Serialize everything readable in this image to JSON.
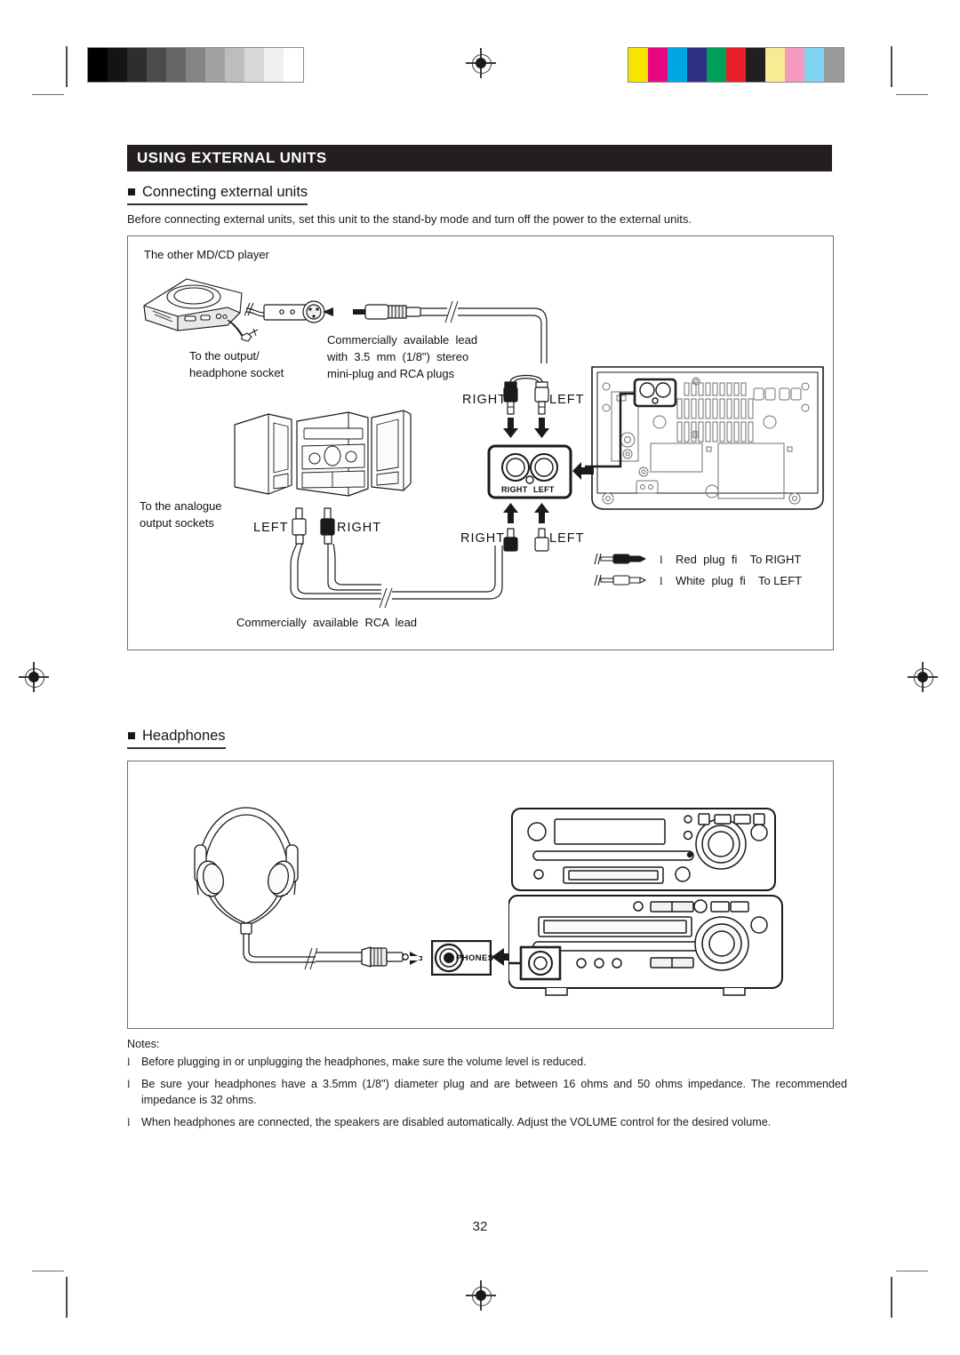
{
  "document": {
    "page_number": "32",
    "section_title": "USING EXTERNAL UNITS"
  },
  "connecting_section": {
    "bullet": "■",
    "heading": "Connecting external units",
    "intro": "Before connecting external units, set this unit to the stand-by mode and turn off the power to the external units.",
    "labels": {
      "md_player": "The other MD/CD player",
      "output_socket": "To the output/\nheadphone socket",
      "lead_desc": "Commercially  available  lead\nwith  3.5  mm  (1/8\")  stereo\nmini-plug and RCA plugs",
      "top_right": "RIGHT",
      "top_left": "LEFT",
      "jack_right": "RIGHT",
      "jack_left": "LEFT",
      "panel_right": "RIGHT",
      "panel_left": "LEFT",
      "analogue_sockets": "To the analogue\noutput sockets",
      "stereo_left": "LEFT",
      "stereo_right": "RIGHT",
      "rca_lead": "Commercially  available  RCA  lead"
    },
    "plug_legend": [
      {
        "bullet": "l",
        "text": "Red  plug  fi    To RIGHT"
      },
      {
        "bullet": "l",
        "text": "White  plug  fi    To LEFT"
      }
    ]
  },
  "headphones_section": {
    "bullet": "■",
    "heading": "Headphones",
    "jack_label": "PHONES"
  },
  "notes": {
    "title": "Notes:",
    "bullet": "l",
    "items": [
      "Before plugging in or unplugging the headphones, make sure the volume level is reduced.",
      "Be sure your headphones have a 3.5mm (1/8\") diameter plug and are between 16 ohms and 50 ohms impedance. The recommended impedance is 32 ohms.",
      "When headphones are connected, the speakers are disabled automatically. Adjust the VOLUME control for the desired volume."
    ]
  },
  "print_marks": {
    "grayscale_steps": [
      "#000000",
      "#141414",
      "#2e2e2e",
      "#4b4b4b",
      "#666666",
      "#858585",
      "#a2a2a2",
      "#bdbdbd",
      "#d8d8d8",
      "#efefef",
      "#ffffff"
    ],
    "color_steps": [
      "#f7e400",
      "#e8077e",
      "#00a7e3",
      "#2e2f85",
      "#00a05a",
      "#e8202a",
      "#231f20",
      "#f9eb93",
      "#f49ac1",
      "#7fd4f2",
      "#9a9a9a"
    ]
  }
}
